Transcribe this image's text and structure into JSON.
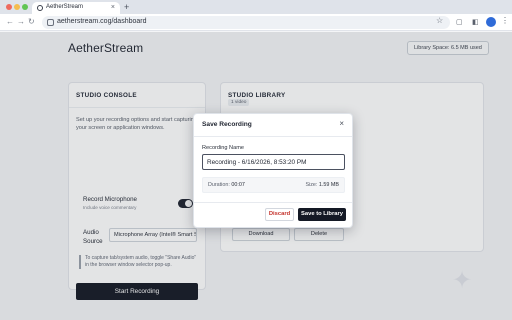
{
  "browser": {
    "tab_title": "AetherStream",
    "tab_close": "×",
    "new_tab": "+",
    "url": "aetherstream.cog/dashboard"
  },
  "page": {
    "brand": "AetherStream",
    "storage_label": "Library Space: 6.5 MB used"
  },
  "console": {
    "heading": "STUDIO CONSOLE",
    "intro": "Set up your recording options and start capturing your screen or application windows.",
    "mic_label": "Record Microphone",
    "mic_sub": "Include voice commentary",
    "mic_enabled": true,
    "audio_label": "Audio Source",
    "audio_value": "Microphone Array (Intel® Smart Sound Technology)",
    "hint": "To capture tab/system audio, toggle \"Share Audio\" in the browser window selector pop-up.",
    "start_label": "Start Recording"
  },
  "library": {
    "heading": "STUDIO LIBRARY",
    "count_badge": "1 video",
    "download_label": "Download",
    "delete_label": "Delete"
  },
  "modal": {
    "title": "Save Recording",
    "close": "×",
    "name_label": "Recording Name",
    "name_value": "Recording - 6/16/2026, 8:53:20 PM",
    "duration_label": "Duration:",
    "duration_value": "00:07",
    "size_label": "Size:",
    "size_value": "1.59 MB",
    "discard_label": "Discard",
    "save_label": "Save to Library"
  },
  "colors": {
    "primary": "#141925",
    "danger": "#c4322b"
  }
}
